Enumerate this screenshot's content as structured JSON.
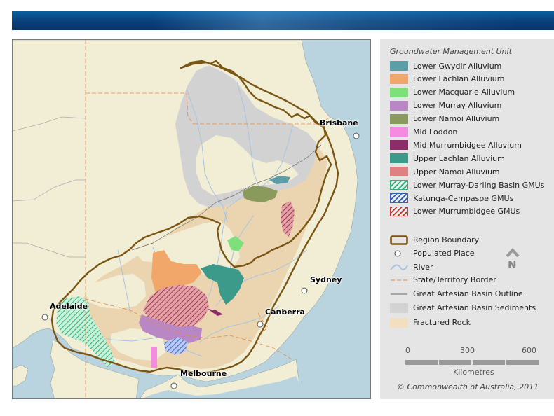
{
  "legend": {
    "title": "Groundwater Management Unit",
    "units": [
      {
        "label": "Lower Gwydir Alluvium",
        "color": "#5c9ea8",
        "pattern": "solid"
      },
      {
        "label": "Lower Lachlan Alluvium",
        "color": "#f2a76a",
        "pattern": "solid"
      },
      {
        "label": "Lower Macquarie Alluvium",
        "color": "#7ee07a",
        "pattern": "solid"
      },
      {
        "label": "Lower Murray Alluvium",
        "color": "#b987c4",
        "pattern": "solid"
      },
      {
        "label": "Lower Namoi Alluvium",
        "color": "#8a9a5c",
        "pattern": "solid"
      },
      {
        "label": "Mid Loddon",
        "color": "#f58be0",
        "pattern": "solid"
      },
      {
        "label": "Mid Murrumbidgee Alluvium",
        "color": "#8a2d68",
        "pattern": "solid"
      },
      {
        "label": "Upper Lachlan Alluvium",
        "color": "#3c9a8a",
        "pattern": "solid"
      },
      {
        "label": "Upper Namoi Alluvium",
        "color": "#e08080",
        "pattern": "solid"
      },
      {
        "label": "Lower Murray-Darling Basin GMUs",
        "color": "#2fb27a",
        "pattern": "hatch"
      },
      {
        "label": "Katunga-Campaspe GMUs",
        "color": "#3a5fc8",
        "pattern": "hatch"
      },
      {
        "label": "Lower Murrumbidgee GMUs",
        "color": "#c23a3a",
        "pattern": "hatch"
      }
    ],
    "reference": [
      {
        "label": "Region Boundary",
        "symbol": "region-boundary"
      },
      {
        "label": "Populated Place",
        "symbol": "populated-place"
      },
      {
        "label": "River",
        "symbol": "river"
      },
      {
        "label": "State/Territory Border",
        "symbol": "state-border"
      },
      {
        "label": "Great Artesian Basin Outline",
        "symbol": "gab-outline"
      },
      {
        "label": "Great Artesian Basin Sediments",
        "symbol": "gab-sediments",
        "color": "#d3d3d3"
      },
      {
        "label": "Fractured Rock",
        "symbol": "fractured-rock",
        "color": "#f3dfc0"
      }
    ],
    "north_label": "N",
    "scale": {
      "ticks": [
        "0",
        "300",
        "600"
      ],
      "unit": "Kilometres"
    },
    "copyright": "© Commonwealth of Australia, 2011"
  },
  "map": {
    "cities": [
      {
        "name": "Brisbane"
      },
      {
        "name": "Sydney"
      },
      {
        "name": "Canberra"
      },
      {
        "name": "Adelaide"
      },
      {
        "name": "Melbourne"
      }
    ],
    "colors": {
      "land": "#f2eed6",
      "sea": "#b9d3df",
      "boundary": "#7a5514",
      "fractured": "#ead5b0",
      "sediments": "#d2d2d2",
      "river": "#a8c4e0"
    }
  }
}
